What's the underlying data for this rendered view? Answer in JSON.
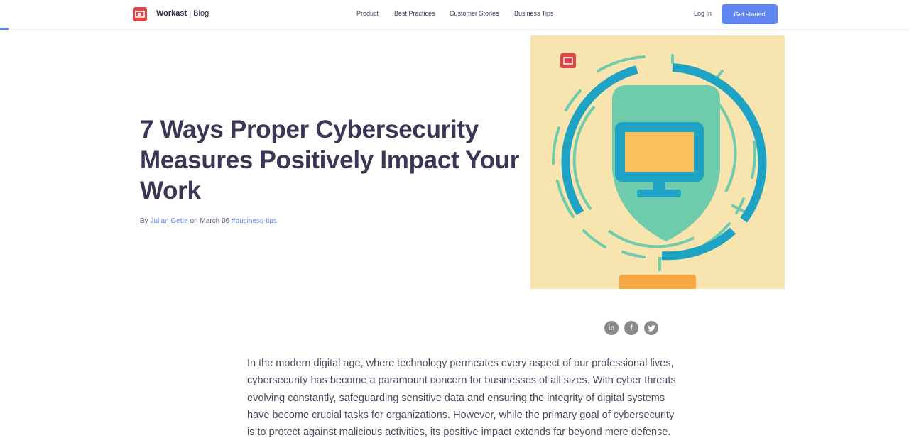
{
  "header": {
    "brand_name": "Workast",
    "brand_suffix": " | Blog",
    "nav": [
      {
        "label": "Product"
      },
      {
        "label": "Best Practices"
      },
      {
        "label": "Customer Stories"
      },
      {
        "label": "Business Tips"
      }
    ],
    "login_label": "Log In",
    "cta_label": "Get started"
  },
  "article": {
    "title": "7 Ways Proper Cybersecurity Measures Positively Impact Your Work",
    "meta": {
      "by": "By ",
      "author": "Julian Gette",
      "on": " on March 06 ",
      "tag": "#business-tips"
    },
    "intro": "In the modern digital age, where technology permeates every aspect of our professional lives, cybersecurity has become a paramount concern for businesses of all sizes. With cyber threats evolving constantly, safeguarding sensitive data and ensuring the integrity of digital systems have become crucial tasks for organizations. However, while the primary goal of cybersecurity is to protect against malicious activities, its positive impact extends far beyond mere defense."
  },
  "share": [
    {
      "icon": "linkedin-icon",
      "glyph": "in"
    },
    {
      "icon": "facebook-icon",
      "glyph": "f"
    },
    {
      "icon": "twitter-icon",
      "glyph": "t"
    }
  ],
  "colors": {
    "accent": "#5f86f0",
    "brand_red": "#e04848",
    "title": "#3a3656",
    "hero_bg": "#f7e4ae",
    "shield": "#6ecbab",
    "ring": "#1fa3c4",
    "screen": "#fbc15c"
  }
}
